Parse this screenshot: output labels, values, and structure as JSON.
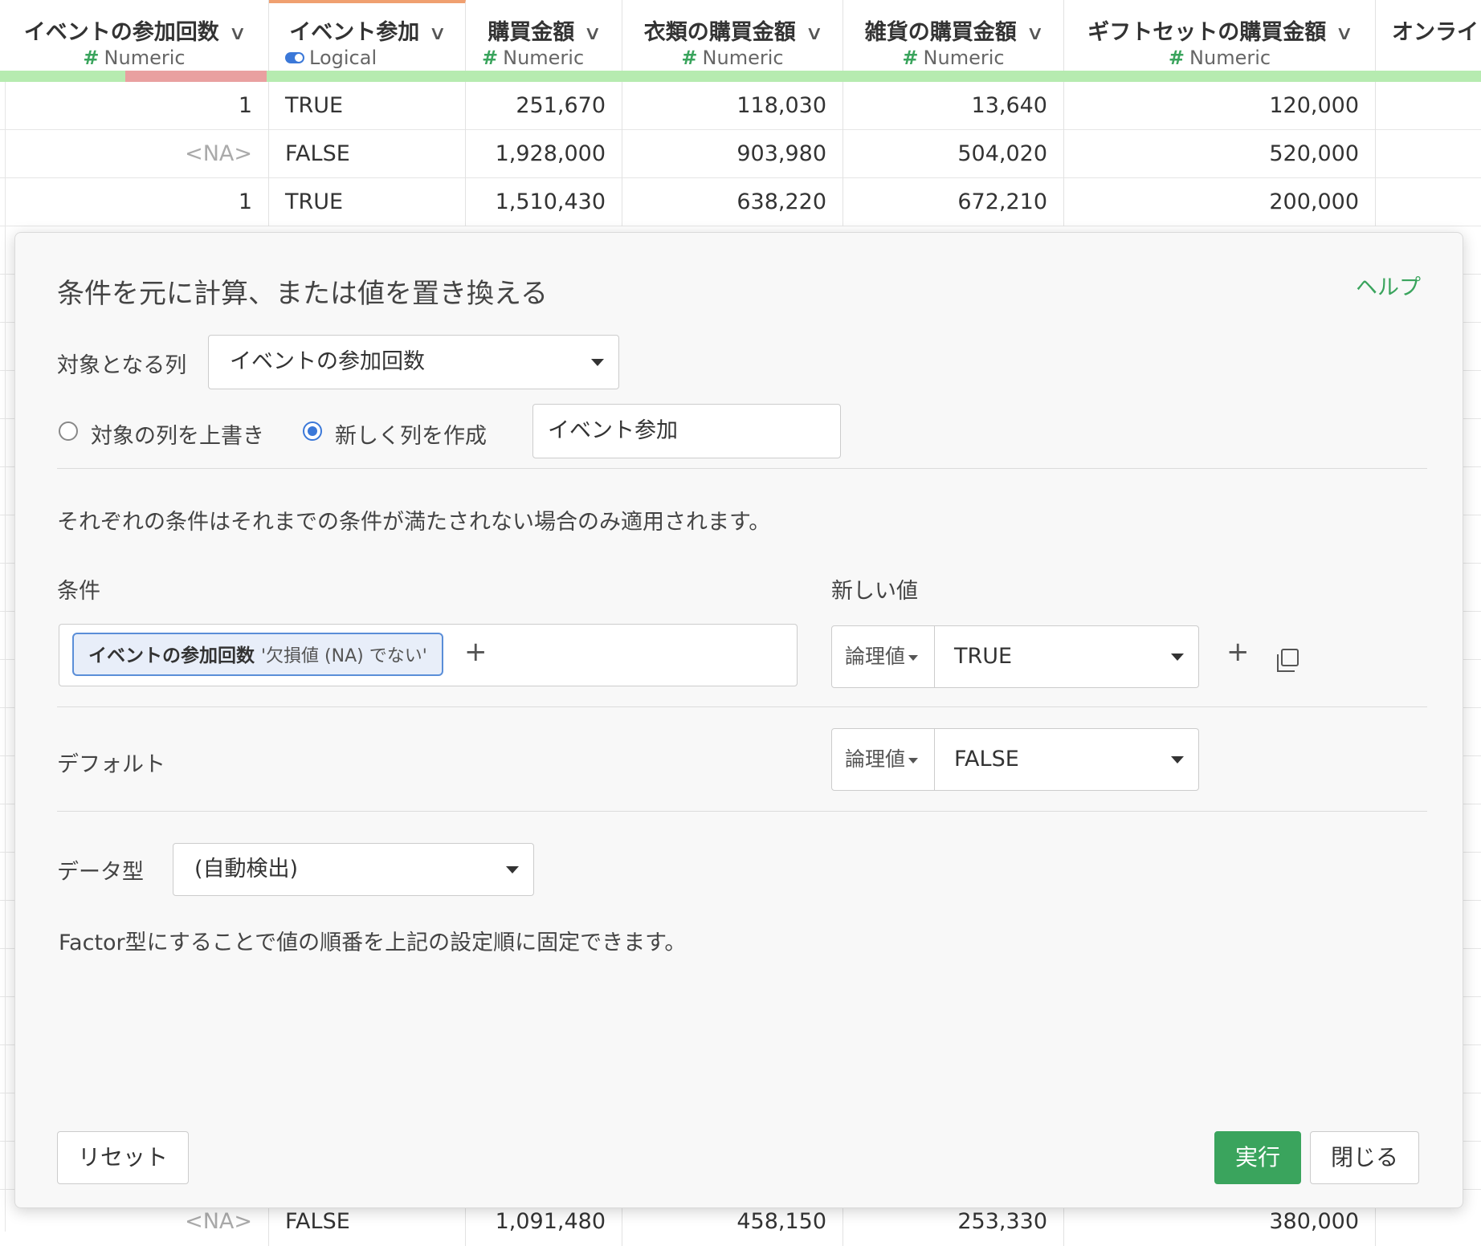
{
  "table": {
    "columns": [
      {
        "name": "イベントの参加回数",
        "type": "Numeric",
        "type_icon": "hash-icon"
      },
      {
        "name": "イベント参加",
        "type": "Logical",
        "type_icon": "toggle-icon"
      },
      {
        "name": "購買金額",
        "type": "Numeric",
        "type_icon": "hash-icon"
      },
      {
        "name": "衣類の購買金額",
        "type": "Numeric",
        "type_icon": "hash-icon"
      },
      {
        "name": "雑貨の購買金額",
        "type": "Numeric",
        "type_icon": "hash-icon"
      },
      {
        "name": "ギフトセットの購買金額",
        "type": "Numeric",
        "type_icon": "hash-icon"
      },
      {
        "name": "オンライ",
        "type": "",
        "type_icon": ""
      }
    ],
    "rows": [
      [
        "1",
        "TRUE",
        "251,670",
        "118,030",
        "13,640",
        "120,000",
        ""
      ],
      [
        "<NA>",
        "FALSE",
        "1,928,000",
        "903,980",
        "504,020",
        "520,000",
        ""
      ],
      [
        "1",
        "TRUE",
        "1,510,430",
        "638,220",
        "672,210",
        "200,000",
        ""
      ]
    ],
    "bottom_row": [
      "<NA>",
      "FALSE",
      "1,091,480",
      "458,150",
      "253,330",
      "380,000",
      ""
    ]
  },
  "dialog": {
    "title": "条件を元に計算、または値を置き換える",
    "help": "ヘルプ",
    "target_label": "対象となる列",
    "target_value": "イベントの参加回数",
    "radio_overwrite": "対象の列を上書き",
    "radio_new": "新しく列を作成",
    "new_column_name": "イベント参加",
    "note": "それぞれの条件はそれまでの条件が満たされない場合のみ適用されます。",
    "condition_label": "条件",
    "new_value_label": "新しい値",
    "condition_chip_column": "イベントの参加回数",
    "condition_chip_text": "'欠損値 (NA) でない'",
    "value_type": "論理値",
    "value": "TRUE",
    "default_label": "デフォルト",
    "default_type": "論理値",
    "default_value": "FALSE",
    "data_type_label": "データ型",
    "data_type_value": "(自動検出)",
    "factor_note": "Factor型にすることで値の順番を上記の設定順に固定できます。",
    "reset": "リセット",
    "run": "実行",
    "close": "閉じる",
    "plus": "+"
  }
}
